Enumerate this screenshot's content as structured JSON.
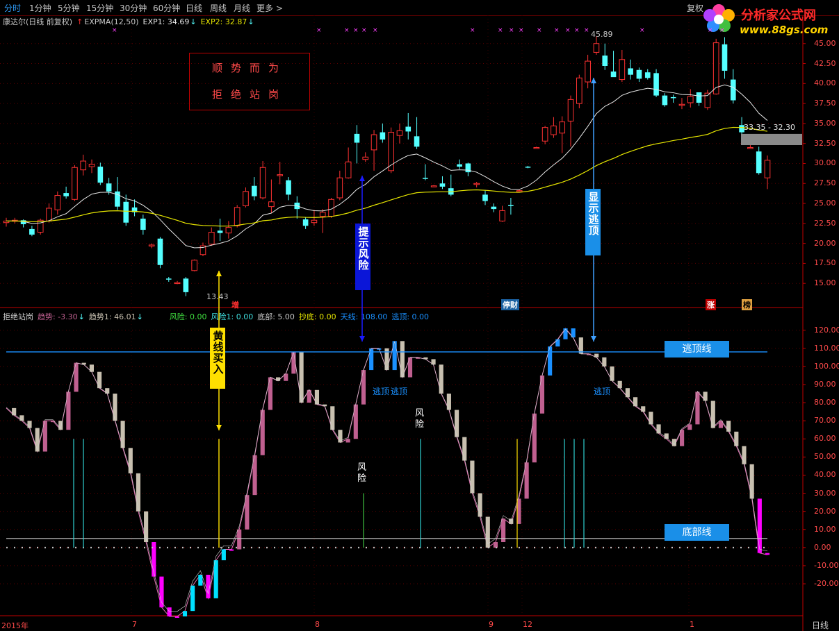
{
  "tabs": [
    "分时",
    "1分钟",
    "5分钟",
    "15分钟",
    "30分钟",
    "60分钟",
    "日线",
    "周线",
    "月线",
    "更多 >"
  ],
  "fq": "复权",
  "logo": {
    "name": "分析家公式网",
    "url": "www.88gs.com"
  },
  "main_info": {
    "title": "康达尔(日线 前复权)",
    "arrow": "↑",
    "expma": "EXPMA(12,50)",
    "exp1": "EXP1: 34.69",
    "exp1_arrow": "↓",
    "exp2": "EXP2: 32.87",
    "exp2_arrow": "↓"
  },
  "sub_info": {
    "name": "拒绝站岗",
    "trend": "趋势: -3.30",
    "trend_arrow": "↓",
    "trend1": "趋势1: 46.01",
    "trend1_arrow": "↓",
    "risk": "风险: 0.00",
    "risk1": "风险1: 0.00",
    "bottom": "底部: 5.00",
    "buy_bottom": "抄底: 0.00",
    "sky": "天线: 108.00",
    "escape": "逃顶: 0.00"
  },
  "box": {
    "line1": "顺势而为",
    "line2": "拒绝站岗"
  },
  "annotations": {
    "risk_hint": "提示风险",
    "escape_show": "显示逃顶",
    "yellow_buy": "黄线买入",
    "escape_line": "逃顶线",
    "bottom_line": "底部线",
    "escape1": "逃顶",
    "escape2": "逃顶",
    "escape3": "逃顶",
    "risk_a": "风险",
    "risk_b": "风险"
  },
  "price_labels": {
    "high": "45.89",
    "low": "13.43",
    "range": "33.35 - 32.30"
  },
  "tags": {
    "zeng": "增",
    "fucai": "停财",
    "zhang": "涨",
    "bang": "榜"
  },
  "xlabels": {
    "y2015": "2015年",
    "m7": "7",
    "m8": "8",
    "m9": "9",
    "m12": "12",
    "m1": "1"
  },
  "day_label": "日线",
  "colors": {
    "up": "#ff3232",
    "down": "#54ffff",
    "exp1": "#e6e6e6",
    "exp2": "#e6e600",
    "axis": "#c00000",
    "pink": "#c06090",
    "beige": "#c8c0b0",
    "magenta": "#ff00ff",
    "cyan": "#00e0ff",
    "blue": "#1a90ff"
  },
  "chart_data": [
    {
      "type": "candlestick",
      "title": "康达尔(日线 前复权)",
      "y_ticks": [
        "45.00",
        "42.50",
        "40.00",
        "37.50",
        "35.00",
        "32.50",
        "30.00",
        "27.50",
        "25.00",
        "22.50",
        "20.00",
        "17.50",
        "15.00"
      ],
      "ylim": [
        12.5,
        45.5
      ],
      "candles": [
        [
          22.6,
          23.2,
          22.1,
          22.8
        ],
        [
          22.8,
          23.2,
          22.5,
          22.9
        ],
        [
          22.9,
          23.0,
          22.0,
          22.4
        ],
        [
          21.8,
          22.2,
          20.9,
          21.1
        ],
        [
          21.4,
          23.1,
          21.1,
          22.9
        ],
        [
          22.8,
          25.0,
          22.6,
          24.4
        ],
        [
          24.2,
          26.5,
          23.6,
          26.0
        ],
        [
          26.3,
          27.1,
          25.6,
          25.9
        ],
        [
          25.5,
          29.8,
          25.3,
          29.5
        ],
        [
          29.2,
          31.1,
          28.5,
          30.3
        ],
        [
          29.6,
          30.5,
          28.8,
          29.9
        ],
        [
          29.6,
          30.1,
          27.3,
          27.6
        ],
        [
          27.5,
          28.2,
          26.1,
          26.5
        ],
        [
          26.5,
          28.3,
          24.2,
          24.6
        ],
        [
          25.2,
          26.1,
          22.2,
          22.6
        ],
        [
          24.5,
          25.5,
          23.4,
          23.9
        ],
        [
          23.1,
          23.6,
          21.1,
          21.7
        ],
        [
          19.8,
          20.0,
          19.4,
          19.8
        ],
        [
          20.6,
          20.8,
          16.9,
          17.3
        ],
        [
          15.6,
          15.8,
          15.2,
          15.5
        ],
        [
          15.1,
          15.3,
          14.9,
          15.1
        ],
        [
          15.6,
          15.8,
          13.4,
          13.9
        ],
        [
          16.6,
          18.0,
          16.5,
          17.9
        ],
        [
          18.6,
          20.1,
          18.4,
          19.7
        ],
        [
          19.9,
          22.0,
          19.7,
          21.4
        ],
        [
          21.6,
          23.1,
          20.3,
          21.3
        ],
        [
          21.3,
          22.8,
          20.6,
          22.0
        ],
        [
          22.2,
          24.8,
          22.0,
          24.5
        ],
        [
          24.7,
          27.0,
          24.5,
          26.5
        ],
        [
          27.2,
          28.3,
          25.4,
          25.9
        ],
        [
          25.7,
          30.3,
          25.5,
          29.5
        ],
        [
          24.6,
          28.0,
          23.8,
          25.2
        ],
        [
          28.5,
          30.2,
          27.4,
          28.6
        ],
        [
          27.9,
          28.3,
          25.4,
          26.1
        ],
        [
          25.1,
          25.9,
          23.1,
          24.3
        ],
        [
          23.0,
          23.3,
          21.8,
          22.2
        ],
        [
          22.6,
          24.2,
          22.2,
          22.9
        ],
        [
          23.4,
          24.3,
          21.3,
          23.9
        ],
        [
          23.4,
          25.7,
          23.2,
          25.5
        ],
        [
          25.7,
          29.1,
          25.4,
          28.2
        ],
        [
          28.2,
          32.0,
          28.1,
          30.2
        ],
        [
          33.7,
          34.8,
          30.0,
          32.6
        ],
        [
          30.5,
          31.4,
          30.2,
          30.8
        ],
        [
          31.7,
          34.2,
          29.1,
          33.6
        ],
        [
          33.9,
          35.0,
          32.6,
          33.0
        ],
        [
          29.1,
          34.5,
          28.8,
          33.9
        ],
        [
          33.5,
          35.0,
          32.5,
          34.1
        ],
        [
          34.6,
          36.3,
          33.0,
          34.0
        ],
        [
          33.4,
          35.8,
          31.8,
          32.1
        ],
        [
          28.2,
          29.9,
          27.9,
          28.1
        ],
        [
          27.2,
          27.3,
          27.1,
          27.2
        ],
        [
          27.5,
          28.4,
          26.8,
          27.1
        ],
        [
          26.9,
          28.6,
          25.9,
          26.1
        ],
        [
          29.9,
          30.5,
          29.3,
          29.6
        ],
        [
          30.0,
          30.1,
          28.4,
          28.9
        ],
        [
          27.5,
          27.7,
          27.0,
          27.5
        ],
        [
          26.1,
          26.6,
          24.8,
          25.3
        ],
        [
          24.6,
          25.0,
          23.9,
          24.3
        ],
        [
          22.8,
          24.7,
          22.7,
          24.1
        ],
        [
          24.8,
          25.7,
          23.6,
          24.7
        ],
        [
          26.6,
          26.7,
          26.5,
          26.6
        ],
        [
          29.6,
          29.7,
          29.4,
          29.5
        ],
        [
          32.0,
          32.1,
          31.9,
          32.0
        ],
        [
          32.8,
          34.7,
          32.4,
          34.5
        ],
        [
          33.6,
          35.8,
          33.2,
          34.7
        ],
        [
          33.8,
          35.9,
          31.3,
          35.2
        ],
        [
          35.3,
          38.5,
          32.1,
          38.0
        ],
        [
          37.5,
          41.1,
          36.9,
          40.7
        ],
        [
          40.2,
          43.6,
          39.4,
          42.8
        ],
        [
          43.9,
          45.9,
          43.6,
          45.0
        ],
        [
          43.5,
          45.0,
          41.7,
          42.2
        ],
        [
          41.5,
          44.1,
          41.0,
          40.8
        ],
        [
          40.5,
          44.2,
          40.2,
          43.0
        ],
        [
          41.9,
          43.0,
          40.5,
          41.1
        ],
        [
          41.7,
          42.0,
          40.2,
          40.6
        ],
        [
          41.4,
          41.8,
          40.5,
          40.7
        ],
        [
          41.3,
          41.8,
          38.3,
          38.5
        ],
        [
          38.5,
          38.8,
          37.1,
          37.3
        ],
        [
          38.3,
          38.6,
          37.6,
          38.2
        ],
        [
          37.3,
          38.2,
          36.8,
          37.4
        ],
        [
          37.6,
          39.3,
          37.0,
          38.4
        ],
        [
          38.9,
          38.1,
          37.2,
          37.6
        ],
        [
          37.0,
          39.2,
          36.7,
          38.8
        ],
        [
          38.7,
          45.6,
          38.6,
          45.1
        ],
        [
          44.9,
          45.8,
          40.6,
          41.6
        ],
        [
          40.5,
          41.8,
          37.5,
          37.9
        ],
        [
          34.8,
          35.8,
          33.5,
          33.9
        ],
        [
          32.0,
          33.0,
          31.9,
          32.0
        ],
        [
          31.5,
          32.1,
          28.6,
          28.8
        ],
        [
          28.2,
          31.0,
          26.8,
          30.4
        ]
      ],
      "exp1_label": "EXP1: 34.69",
      "exp2_label": "EXP2: 32.87"
    },
    {
      "type": "bar",
      "title": "拒绝站岗",
      "y_ticks": [
        "120.00",
        "110.00",
        "100.00",
        "90.00",
        "80.00",
        "70.00",
        "60.00",
        "50.00",
        "40.00",
        "30.00",
        "20.00",
        "10.00",
        "0.00",
        "-10.00",
        "-20.00"
      ],
      "ylim": [
        -38,
        126
      ],
      "escape_line": 108,
      "bottom_line": 5,
      "trend": [
        77,
        73,
        70,
        66,
        53,
        70,
        70,
        65,
        86,
        102,
        101,
        97,
        88,
        85,
        70,
        55,
        41,
        20,
        3,
        -16,
        -33,
        -38,
        -38,
        -35,
        -21,
        -15,
        -28,
        -7,
        -1,
        -1,
        10,
        29,
        51,
        76,
        94,
        92,
        96,
        108,
        80,
        87,
        79,
        78,
        65,
        58,
        60,
        79,
        98,
        110,
        110,
        98,
        114,
        94,
        105,
        105,
        104,
        101,
        85,
        76,
        61,
        48,
        30,
        17,
        0,
        3,
        16,
        13,
        27,
        47,
        74,
        95,
        111,
        115,
        121,
        116,
        107,
        107,
        105,
        100,
        92,
        88,
        83,
        78,
        75,
        68,
        63,
        60,
        56,
        65,
        68,
        86,
        81,
        66,
        70,
        64,
        56,
        46,
        27,
        -3,
        -4
      ]
    }
  ]
}
